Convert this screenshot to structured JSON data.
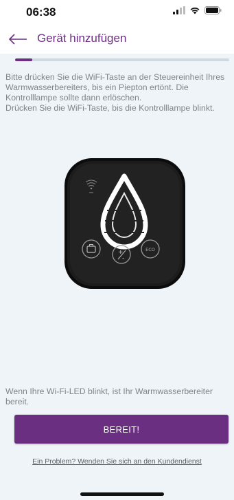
{
  "status_bar": {
    "time": "06:38"
  },
  "header": {
    "title": "Gerät hinzufügen"
  },
  "progress": {
    "fraction": 0.08
  },
  "instructions": {
    "paragraph_1": "Bitte drücken Sie die WiFi-Taste an der Steuereinheit Ihres Warmwasserbereiters, bis ein Piepton ertönt. Die Kontrolllampe sollte dann erlöschen.",
    "paragraph_2": "Drücken Sie die WiFi-Taste, bis die Kontrolllampe blinkt."
  },
  "device": {
    "eco_label": "ECO"
  },
  "ready": {
    "text": "Wenn Ihre Wi-Fi-LED blinkt, ist Ihr Warmwasserbereiter bereit.",
    "button_label": "BEREIT!"
  },
  "problem_link": "Ein Problem? Wenden Sie sich an den Kundendienst",
  "colors": {
    "accent": "#6a2f80",
    "background": "#eef4f7"
  }
}
